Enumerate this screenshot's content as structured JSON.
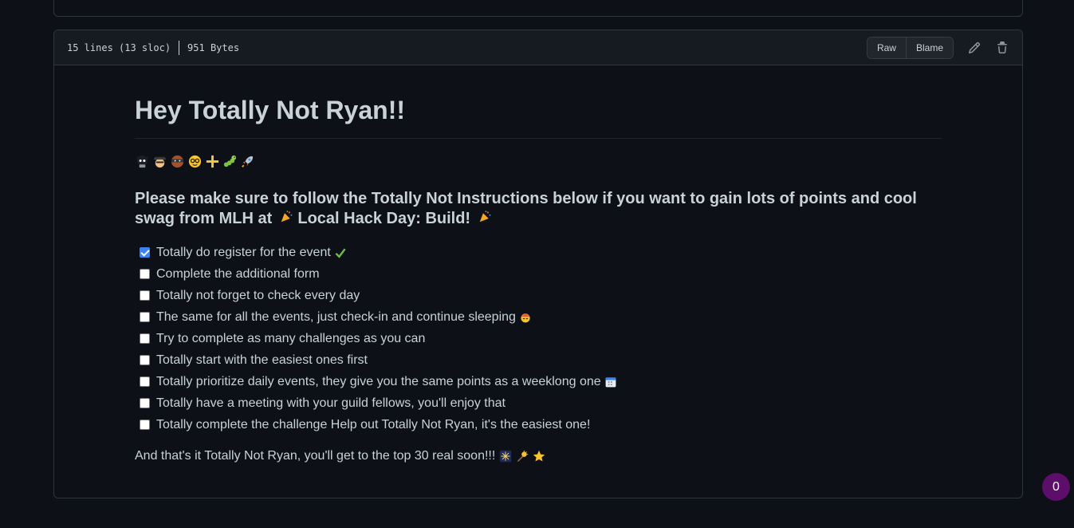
{
  "file_header": {
    "lines_info": "15 lines (13 sloc)",
    "size_info": "951 Bytes",
    "raw_label": "Raw",
    "blame_label": "Blame"
  },
  "readme": {
    "title": "Hey Totally Not Ryan!!",
    "emoji_row": [
      "octocat-emoji",
      "spy-emoji",
      "ninja-emoji",
      "nerd-face-emoji",
      "plus-emoji",
      "bug-emoji",
      "rocket-emoji"
    ],
    "subtitle_before": "Please make sure to follow the Totally Not Instructions below if you want to gain lots of points and cool swag from MLH at",
    "subtitle_event": "Local Hack Day: Build!",
    "tasks": [
      {
        "label": "Totally do register for the event",
        "checked": true,
        "emoji": "check-mark-emoji"
      },
      {
        "label": "Complete the additional form",
        "checked": false
      },
      {
        "label": "Totally not forget to check every day",
        "checked": false
      },
      {
        "label": "The same for all the events, just check-in and continue sleeping",
        "checked": false,
        "emoji": "sleepy-emoji"
      },
      {
        "label": "Try to complete as many challenges as you can",
        "checked": false
      },
      {
        "label": "Totally start with the easiest ones first",
        "checked": false
      },
      {
        "label": "Totally prioritize daily events, they give you the same points as a weeklong one",
        "checked": false,
        "emoji": "calendar-emoji"
      },
      {
        "label": "Totally have a meeting with your guild fellows, you'll enjoy that",
        "checked": false
      },
      {
        "label": "Totally complete the challenge Help out Totally Not Ryan, it's the easiest one!",
        "checked": false
      }
    ],
    "closing": "And that's it Totally Not Ryan, you'll get to the top 30 real soon!!!"
  },
  "notification_badge": {
    "count": "0"
  },
  "colors": {
    "background": "#0d1117",
    "header": "#161b22",
    "border": "#30363d",
    "text": "#c9d1d9",
    "badge": "#5c0e6a",
    "checkbox_checked": "#3b82f6"
  }
}
